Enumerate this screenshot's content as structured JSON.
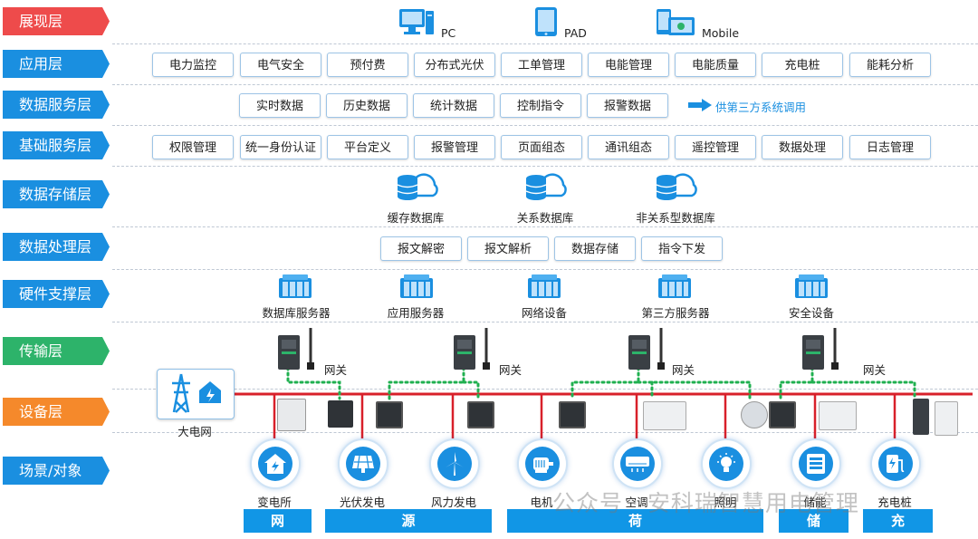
{
  "layers": [
    {
      "label": "展现层",
      "color": "#ee4b4b"
    },
    {
      "label": "应用层",
      "color": "#1a8fe0"
    },
    {
      "label": "数据服务层",
      "color": "#1a8fe0"
    },
    {
      "label": "基础服务层",
      "color": "#1a8fe0"
    },
    {
      "label": "数据存储层",
      "color": "#1a8fe0"
    },
    {
      "label": "数据处理层",
      "color": "#1a8fe0"
    },
    {
      "label": "硬件支撑层",
      "color": "#1a8fe0"
    },
    {
      "label": "传输层",
      "color": "#2db36a"
    },
    {
      "label": "设备层",
      "color": "#f5892b"
    },
    {
      "label": "场景/对象",
      "color": "#1a8fe0"
    }
  ],
  "presentation": {
    "pc": "PC",
    "pad": "PAD",
    "mobile": "Mobile"
  },
  "application": [
    "电力监控",
    "电气安全",
    "预付费",
    "分布式光伏",
    "工单管理",
    "电能管理",
    "电能质量",
    "充电桩",
    "能耗分析"
  ],
  "data_service": {
    "items": [
      "实时数据",
      "历史数据",
      "统计数据",
      "控制指令",
      "报警数据"
    ],
    "note": "供第三方系统调用"
  },
  "base_service": [
    "权限管理",
    "统一身份认证",
    "平台定义",
    "报警管理",
    "页面组态",
    "通讯组态",
    "遥控管理",
    "数据处理",
    "日志管理"
  ],
  "storage": [
    "缓存数据库",
    "关系数据库",
    "非关系型数据库"
  ],
  "processing": [
    "报文解密",
    "报文解析",
    "数据存储",
    "指令下发"
  ],
  "hardware": [
    "数据库服务器",
    "应用服务器",
    "网络设备",
    "第三方服务器",
    "安全设备"
  ],
  "gateway": "网关",
  "grid": "大电网",
  "scenes": [
    "变电所",
    "光伏发电",
    "风力发电",
    "电机",
    "空调",
    "照明",
    "储能",
    "充电桩"
  ],
  "categories": [
    "网",
    "源",
    "荷",
    "储",
    "充"
  ],
  "watermark": "公众号 · 安科瑞智慧用电管理"
}
